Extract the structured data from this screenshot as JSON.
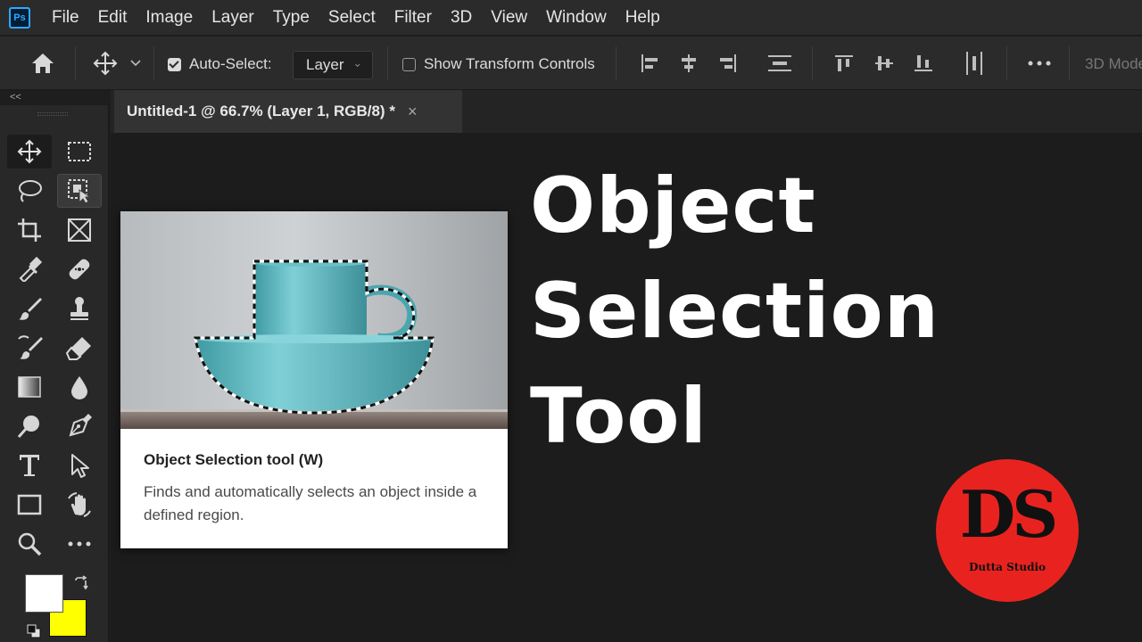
{
  "app": {
    "logo_text": "Ps"
  },
  "menu": [
    "File",
    "Edit",
    "Image",
    "Layer",
    "Type",
    "Select",
    "Filter",
    "3D",
    "View",
    "Window",
    "Help"
  ],
  "options_bar": {
    "auto_select_label": "Auto-Select:",
    "auto_select_checked": true,
    "layer_dropdown_value": "Layer",
    "show_transform_label": "Show Transform Controls",
    "show_transform_checked": false,
    "three_d_mode_label": "3D Mode:"
  },
  "toolbar": {
    "collapse_glyph": "<<",
    "active_tool": "move-tool",
    "highlighted_tool": "object-selection-tool",
    "foreground_color": "#ffffff",
    "background_color": "#ffff00"
  },
  "document_tab": {
    "title": "Untitled-1 @ 66.7% (Layer 1, RGB/8) *",
    "close_glyph": "×"
  },
  "tooltip": {
    "title": "Object Selection tool (W)",
    "description": "Finds and automatically selects an object inside a defined region."
  },
  "headline": {
    "line1": "Object Selection",
    "line2": "Tool"
  },
  "brand": {
    "mark": "DS",
    "name": "Dutta Studio",
    "color": "#e8231f"
  },
  "colors": {
    "accent": "#31a8ff",
    "cup": "#5fb8c0"
  }
}
